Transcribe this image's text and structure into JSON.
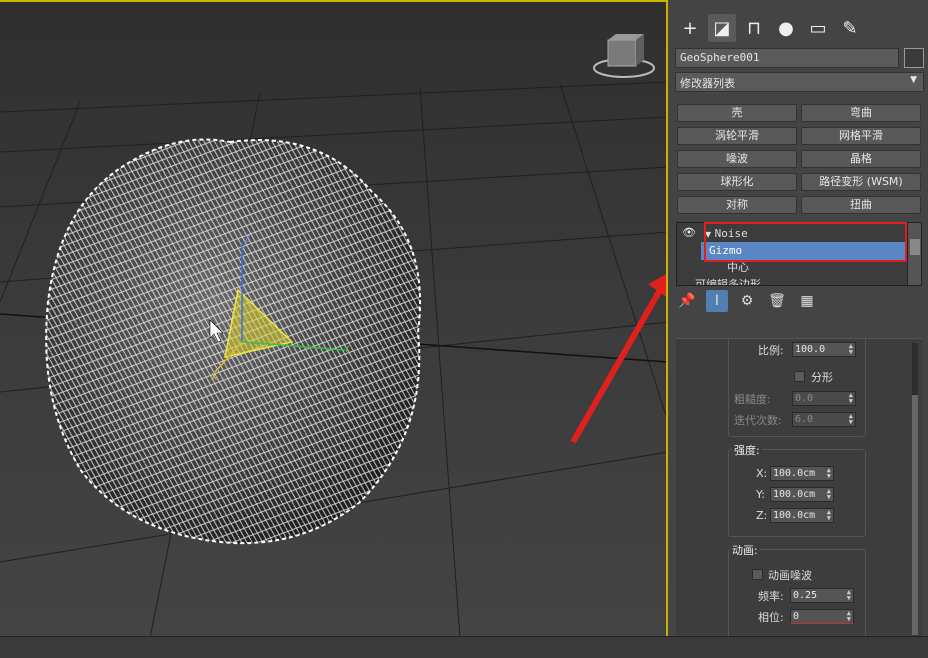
{
  "viewport": {
    "gizmo_axis_x": "X",
    "gizmo_axis_y": "Y",
    "gizmo_axis_z": "Z"
  },
  "panel": {
    "tabs": [
      {
        "icon": "plus-icon",
        "glyph": "+"
      },
      {
        "icon": "modify-icon",
        "glyph": "◪"
      },
      {
        "icon": "hierarchy-icon",
        "glyph": "⊓"
      },
      {
        "icon": "motion-icon",
        "glyph": "●"
      },
      {
        "icon": "display-icon",
        "glyph": "▭"
      },
      {
        "icon": "utilities-icon",
        "glyph": "✎"
      }
    ],
    "object_name": "GeoSphere001",
    "object_color": "#3a3a3a",
    "modifier_list": "修改器列表",
    "modifier_buttons": [
      "壳",
      "弯曲",
      "涡轮平滑",
      "网格平滑",
      "噪波",
      "晶格",
      "球形化",
      "路径变形 (WSM)",
      "对称",
      "扭曲"
    ],
    "stack": {
      "noise": "Noise",
      "gizmo": "Gizmo",
      "center": "中心",
      "base": "可编辑多边形"
    },
    "params": {
      "scale_label": "比例:",
      "scale_value": "100.0",
      "fractal_label": "分形",
      "roughness_label": "粗糙度:",
      "roughness_value": "0.0",
      "iterations_label": "迭代次数:",
      "iterations_value": "6.0",
      "strength_label": "强度:",
      "x_label": "X:",
      "x_value": "100.0cm",
      "y_label": "Y:",
      "y_value": "100.0cm",
      "z_label": "Z:",
      "z_value": "100.0cm",
      "animation_label": "动画:",
      "animate_noise_label": "动画噪波",
      "frequency_label": "频率:",
      "frequency_value": "0.25",
      "phase_label": "相位:",
      "phase_value": "0"
    }
  },
  "colors": {
    "highlight_red": "#e0201e",
    "selected_blue": "#5b86c4",
    "active_border": "#c9b400"
  }
}
